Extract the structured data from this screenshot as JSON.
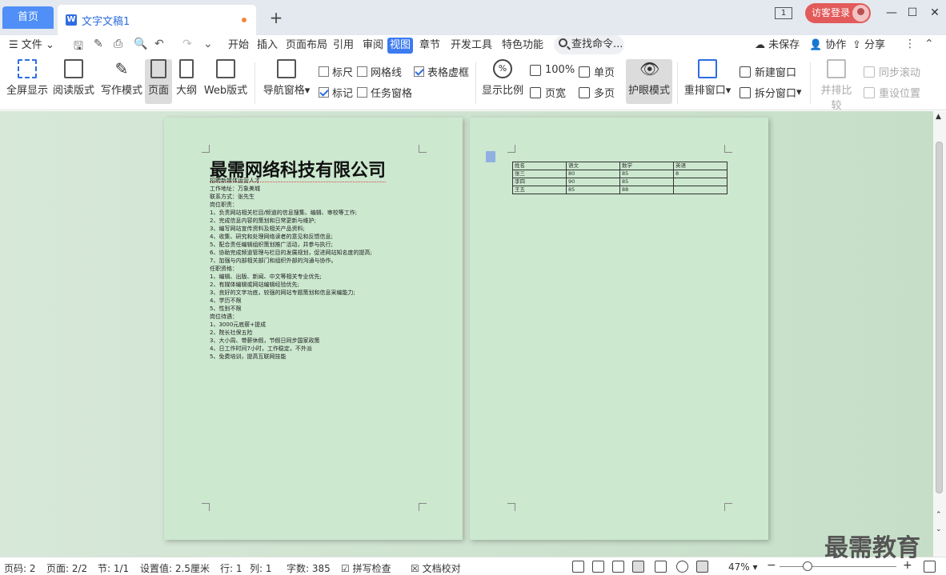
{
  "tabs": {
    "home": "首页",
    "doc": "文字文稿1"
  },
  "titlebar": {
    "page_indicator": "1",
    "login": "访客登录"
  },
  "menu": {
    "file": "文件",
    "items": [
      "开始",
      "插入",
      "页面布局",
      "引用",
      "审阅",
      "视图",
      "章节",
      "开发工具",
      "特色功能"
    ],
    "search": "查找命令...",
    "unsaved": "未保存",
    "collab": "协作",
    "share": "分享"
  },
  "ribbon": {
    "fullscreen": "全屏显示",
    "read": "阅读版式",
    "write": "写作模式",
    "page": "页面",
    "outline": "大纲",
    "web": "Web版式",
    "nav": "导航窗格",
    "ruler": "标尺",
    "grid": "网格线",
    "table_grid": "表格虚框",
    "mark": "标记",
    "task": "任务窗格",
    "zoom_ratio": "显示比例",
    "zoom100": "100%",
    "page_width": "页宽",
    "single": "单页",
    "multi": "多页",
    "eye": "护眼模式",
    "rearrange": "重排窗口",
    "new_window": "新建窗口",
    "split": "拆分窗口",
    "compare": "并排比较",
    "sync_scroll": "同步滚动",
    "reset_pos": "重设位置"
  },
  "doc": {
    "title": "最需网络科技有限公司",
    "lines": [
      "招聘新媒体运营人才",
      "工作地址：万象美城",
      "联系方式：张先生",
      "岗位职责：",
      "1、负责网站相关栏目/频道的信息搜集、编辑、审校等工作;",
      "2、完成信息内容的策划和日常更新与维护;",
      "3、编写网站宣传资料及相关产品资料;",
      "4、收集、研究和处理网络读者的意见和反馈信息;",
      "5、配合责任编辑组织策划推广活动，并参与执行;",
      "6、协助完成频道管理与栏目的发展规划，促进网站知名度的提高;",
      "7、加强与内部相关部门和组织外部的沟通与协作。",
      "任职资格：",
      "1、编辑、出版、新闻、中文等相关专业优先;",
      "2、有媒体编辑或网站编辑经验优先;",
      "3、良好的文字功底，较强的网站专题策划和信息采编能力;",
      "4、学历不限",
      "5、性别不限",
      "岗位待遇：",
      "1、3000元底薪+提成",
      "2、院长社保五险",
      "3、大小周、带薪休假，节假日同步国家政策",
      "4、日工作时间7小时，工作稳定，不外派",
      "5、免费培训，提高互联网技能"
    ],
    "table": [
      [
        "姓名",
        "语文",
        "数学",
        "英语"
      ],
      [
        "张三",
        "80",
        "85",
        "8"
      ],
      [
        "李四",
        "90",
        "85",
        ""
      ],
      [
        "王五",
        "85",
        "88",
        ""
      ]
    ]
  },
  "status": {
    "page_num": "页码: 2",
    "pages": "页面: 2/2",
    "section": "节: 1/1",
    "setting": "设置值: 2.5厘米",
    "row": "行: 1",
    "col": "列: 1",
    "words": "字数: 385",
    "spell": "拼写检查",
    "proof": "文档校对",
    "zoom": "47%"
  },
  "watermark": "最需教育"
}
